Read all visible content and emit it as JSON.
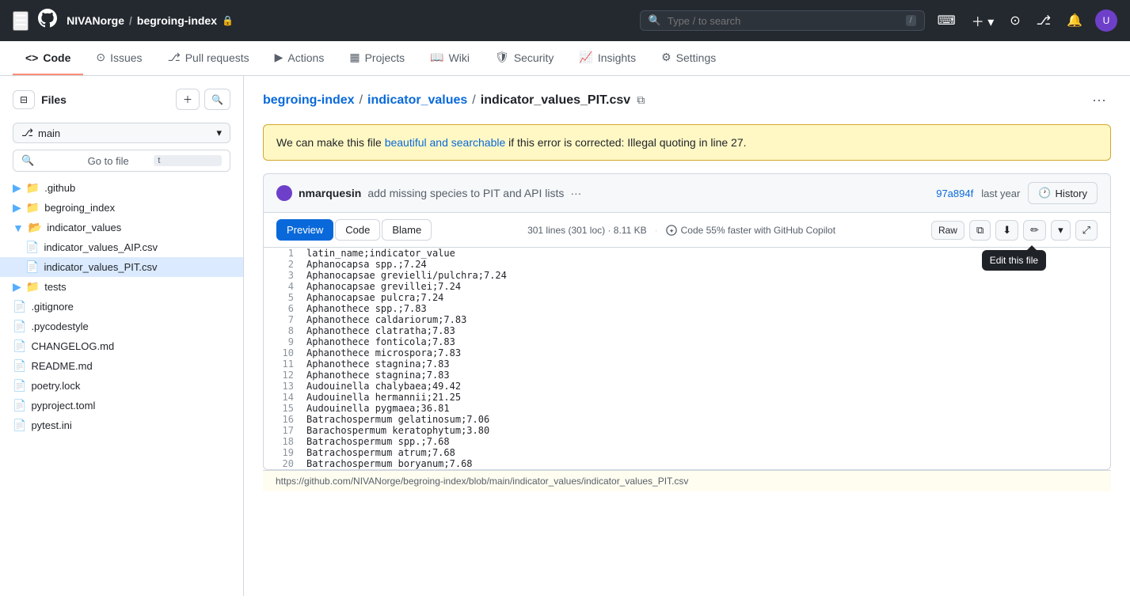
{
  "topnav": {
    "org": "NIVANorge",
    "separator": "/",
    "repo": "begroing-index",
    "lock_icon": "🔒",
    "search_placeholder": "Type / to search",
    "search_kbd": "/",
    "avatar_label": "U"
  },
  "tabs": [
    {
      "label": "Code",
      "icon": "<>",
      "active": true
    },
    {
      "label": "Issues",
      "icon": "⊙"
    },
    {
      "label": "Pull requests",
      "icon": "⎇"
    },
    {
      "label": "Actions",
      "icon": "▶"
    },
    {
      "label": "Projects",
      "icon": "▦"
    },
    {
      "label": "Wiki",
      "icon": "📖"
    },
    {
      "label": "Security",
      "icon": "🛡"
    },
    {
      "label": "Insights",
      "icon": "📈"
    },
    {
      "label": "Settings",
      "icon": "⚙"
    }
  ],
  "sidebar": {
    "title": "Files",
    "branch": "main",
    "go_to_file_placeholder": "Go to file",
    "go_to_file_kbd": "t",
    "tree": [
      {
        "type": "folder",
        "name": ".github",
        "indent": 0,
        "expanded": false
      },
      {
        "type": "folder",
        "name": "begroing_index",
        "indent": 0,
        "expanded": false
      },
      {
        "type": "folder",
        "name": "indicator_values",
        "indent": 0,
        "expanded": true
      },
      {
        "type": "file",
        "name": "indicator_values_AIP.csv",
        "indent": 1,
        "active": false
      },
      {
        "type": "file",
        "name": "indicator_values_PIT.csv",
        "indent": 1,
        "active": true
      },
      {
        "type": "folder",
        "name": "tests",
        "indent": 0,
        "expanded": false
      },
      {
        "type": "file",
        "name": ".gitignore",
        "indent": 0
      },
      {
        "type": "file",
        "name": ".pycodestyle",
        "indent": 0
      },
      {
        "type": "file",
        "name": "CHANGELOG.md",
        "indent": 0
      },
      {
        "type": "file",
        "name": "README.md",
        "indent": 0
      },
      {
        "type": "file",
        "name": "poetry.lock",
        "indent": 0
      },
      {
        "type": "file",
        "name": "pyproject.toml",
        "indent": 0
      },
      {
        "type": "file",
        "name": "pytest.ini",
        "indent": 0
      }
    ]
  },
  "breadcrumb": {
    "root": "begroing-index",
    "folder": "indicator_values",
    "file": "indicator_values_PIT.csv"
  },
  "warning": {
    "text_before": "We can make this file ",
    "link_text": "beautiful and searchable",
    "text_after": " if this error is corrected: Illegal quoting in line 27."
  },
  "commit": {
    "author": "nmarquesin",
    "message": "add missing species to PIT and API lists",
    "extra": "···",
    "hash": "97a894f",
    "time": "last year",
    "history_label": "History"
  },
  "file_toolbar": {
    "tab_preview": "Preview",
    "tab_code": "Code",
    "tab_blame": "Blame",
    "stats": "301 lines (301 loc) · 8.11 KB",
    "copilot_text": "Code 55% faster with GitHub Copilot",
    "raw_label": "Raw"
  },
  "tooltip": {
    "edit_text": "Edit this file"
  },
  "lines": [
    {
      "num": 1,
      "code": "latin_name;indicator_value"
    },
    {
      "num": 2,
      "code": "Aphanocapsa spp.;7.24"
    },
    {
      "num": 3,
      "code": "Aphanocapsae grevielli/pulchra;7.24"
    },
    {
      "num": 4,
      "code": "Aphanocapsae grevillei;7.24"
    },
    {
      "num": 5,
      "code": "Aphanocapsae pulcra;7.24"
    },
    {
      "num": 6,
      "code": "Aphanothece spp.;7.83"
    },
    {
      "num": 7,
      "code": "Aphanothece caldariorum;7.83"
    },
    {
      "num": 8,
      "code": "Aphanothece clatratha;7.83"
    },
    {
      "num": 9,
      "code": "Aphanothece fonticola;7.83"
    },
    {
      "num": 10,
      "code": "Aphanothece microspora;7.83"
    },
    {
      "num": 11,
      "code": "Aphanothece stagnina;7.83"
    },
    {
      "num": 12,
      "code": "Aphanothece stagnina;7.83"
    },
    {
      "num": 13,
      "code": "Audouinella chalybaea;49.42"
    },
    {
      "num": 14,
      "code": "Audouinella hermannii;21.25"
    },
    {
      "num": 15,
      "code": "Audouinella pygmaea;36.81"
    },
    {
      "num": 16,
      "code": "Batrachospermum gelatinosum;7.06"
    },
    {
      "num": 17,
      "code": "Barachospermum keratophytum;3.80"
    },
    {
      "num": 18,
      "code": "Batrachospermum spp.;7.68"
    },
    {
      "num": 19,
      "code": "Batrachospermum atrum;7.68"
    },
    {
      "num": 20,
      "code": "Batrachospermum boryanum;7.68"
    }
  ],
  "bottom_bar": "https://github.com/NIVANorge/begroing-index/blob/main/indicator_values/indicator_values_PIT.csv"
}
